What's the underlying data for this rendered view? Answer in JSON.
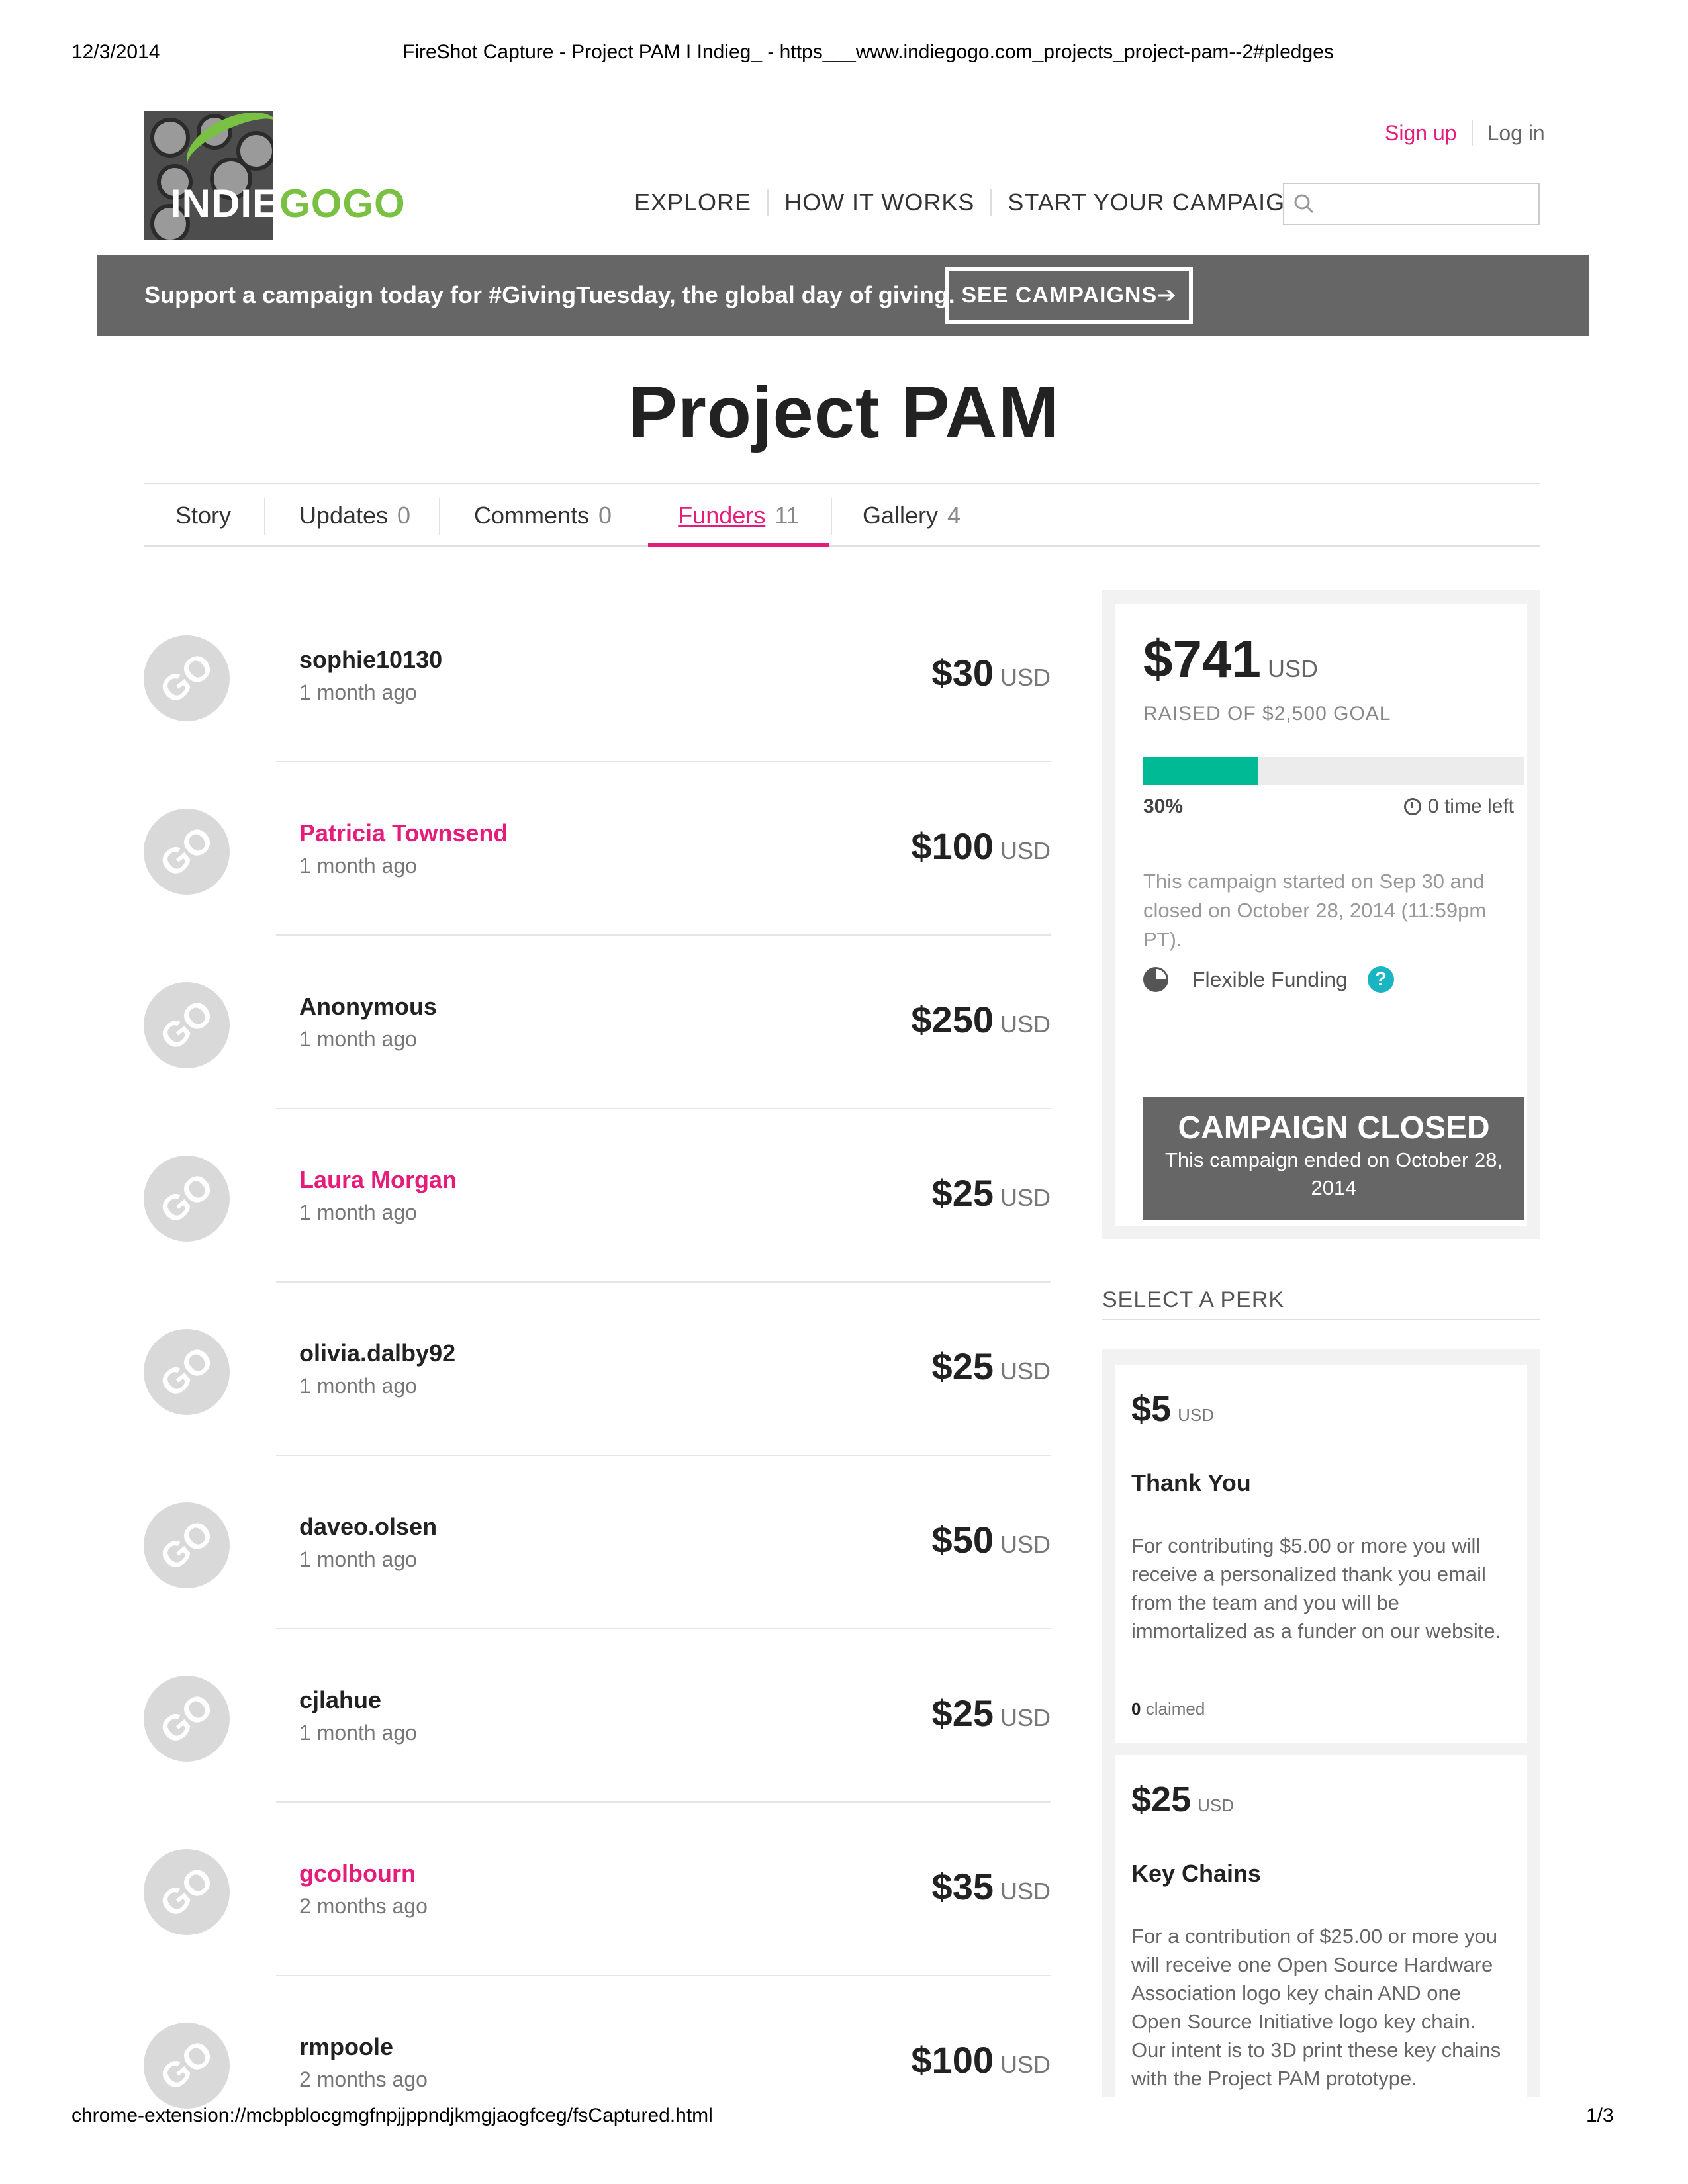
{
  "print": {
    "date": "12/3/2014",
    "title": "FireShot Capture - Project PAM I Indieg_ - https___www.indiegogo.com_projects_project-pam--2#pledges",
    "url": "chrome-extension://mcbpblocgmgfnpjjppndjkmgjaogfceg/fsCaptured.html",
    "page": "1/3"
  },
  "logo": {
    "part1": "INDIE",
    "part2": "GOGO"
  },
  "auth": {
    "signup": "Sign up",
    "login": "Log in"
  },
  "nav": {
    "explore": "EXPLORE",
    "how": "HOW IT WORKS",
    "start": "START YOUR CAMPAIGN",
    "search_placeholder": ""
  },
  "banner": {
    "text": "Support a campaign today for #GivingTuesday, the global day of giving.",
    "button": "SEE CAMPAIGNS➔"
  },
  "title": "Project PAM",
  "tabs": [
    {
      "label": "Story",
      "count": ""
    },
    {
      "label": "Updates",
      "count": "0"
    },
    {
      "label": "Comments",
      "count": "0"
    },
    {
      "label": "Funders",
      "count": "11"
    },
    {
      "label": "Gallery",
      "count": "4"
    }
  ],
  "funders": [
    {
      "name": "sophie10130",
      "time": "1 month ago",
      "amount": "$30",
      "currency": "USD"
    },
    {
      "name": "Patricia Townsend",
      "time": "1 month ago",
      "amount": "$100",
      "currency": "USD"
    },
    {
      "name": "Anonymous",
      "time": "1 month ago",
      "amount": "$250",
      "currency": "USD"
    },
    {
      "name": "Laura Morgan",
      "time": "1 month ago",
      "amount": "$25",
      "currency": "USD"
    },
    {
      "name": "olivia.dalby92",
      "time": "1 month ago",
      "amount": "$25",
      "currency": "USD"
    },
    {
      "name": "daveo.olsen",
      "time": "1 month ago",
      "amount": "$50",
      "currency": "USD"
    },
    {
      "name": "cjlahue",
      "time": "1 month ago",
      "amount": "$25",
      "currency": "USD"
    },
    {
      "name": "gcolbourn",
      "time": "2 months ago",
      "amount": "$35",
      "currency": "USD"
    },
    {
      "name": "rmpoole",
      "time": "2 months ago",
      "amount": "$100",
      "currency": "USD"
    }
  ],
  "avatar_text": "GO",
  "campaign": {
    "raised": "$741",
    "currency": "USD",
    "goal": "RAISED OF $2,500 GOAL",
    "progress": 0.3,
    "percent": "30%",
    "time_left": "0 time left",
    "info": "This campaign started on Sep 30 and closed on October 28, 2014 (11:59pm PT).",
    "funding_type": "Flexible Funding",
    "help": "?",
    "closed_title": "CAMPAIGN CLOSED",
    "closed_sub": "This campaign ended on October 28, 2014"
  },
  "perks_heading": "SELECT A PERK",
  "perks": [
    {
      "price": "$5",
      "currency": "USD",
      "title": "Thank You",
      "desc": "For contributing $5.00 or more you will receive a personalized thank you email from the team and you will be immortalized as a funder on our website.",
      "claimed_count": "0",
      "claimed_label": "claimed"
    },
    {
      "price": "$25",
      "currency": "USD",
      "title": "Key Chains",
      "desc": "For a contribution of $25.00 or more you will receive one Open Source Hardware Association logo key chain AND one Open Source Initiative logo key chain. Our intent is to 3D print these key chains with the Project PAM prototype."
    }
  ],
  "colors": {
    "accent": "#e51c7a",
    "progress": "#00b995",
    "banner": "#666666",
    "logo_green": "#7ac143"
  }
}
